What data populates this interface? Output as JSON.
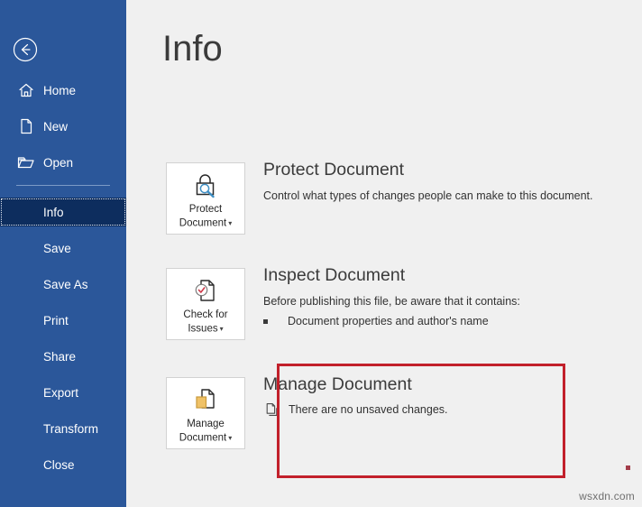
{
  "sidebar": {
    "back_label": "Back",
    "items": [
      {
        "label": "Home",
        "icon": "home-icon",
        "selected": false
      },
      {
        "label": "New",
        "icon": "new-document-icon",
        "selected": false
      },
      {
        "label": "Open",
        "icon": "open-folder-icon",
        "selected": false
      },
      {
        "label": "Info",
        "icon": "",
        "selected": true
      },
      {
        "label": "Save",
        "icon": "",
        "selected": false
      },
      {
        "label": "Save As",
        "icon": "",
        "selected": false
      },
      {
        "label": "Print",
        "icon": "",
        "selected": false
      },
      {
        "label": "Share",
        "icon": "",
        "selected": false
      },
      {
        "label": "Export",
        "icon": "",
        "selected": false
      },
      {
        "label": "Transform",
        "icon": "",
        "selected": false
      },
      {
        "label": "Close",
        "icon": "",
        "selected": false
      }
    ]
  },
  "main": {
    "title": "Info",
    "sections": {
      "protect": {
        "button_line1": "Protect",
        "button_line2": "Document",
        "heading": "Protect Document",
        "description": "Control what types of changes people can make to this document.",
        "icon": "padlock-magnifier-icon"
      },
      "inspect": {
        "button_line1": "Check for",
        "button_line2": "Issues",
        "heading": "Inspect Document",
        "description": "Before publishing this file, be aware that it contains:",
        "bullet": "Document properties and author's name",
        "icon": "document-check-icon"
      },
      "manage": {
        "button_line1": "Manage",
        "button_line2": "Document",
        "heading": "Manage Document",
        "status": "There are no unsaved changes.",
        "icon": "document-versions-icon",
        "status_icon": "copy-documents-icon"
      }
    }
  },
  "annotation": {
    "highlight_color": "#c2202b",
    "dot_color": "#a33c4a"
  },
  "watermark": {
    "text": "wsxdn.com"
  },
  "colors": {
    "sidebar_bg": "#2b579a",
    "sidebar_selected_bg": "#0d2d5e",
    "main_bg": "#f0f0f0",
    "button_bg": "#ffffff"
  }
}
